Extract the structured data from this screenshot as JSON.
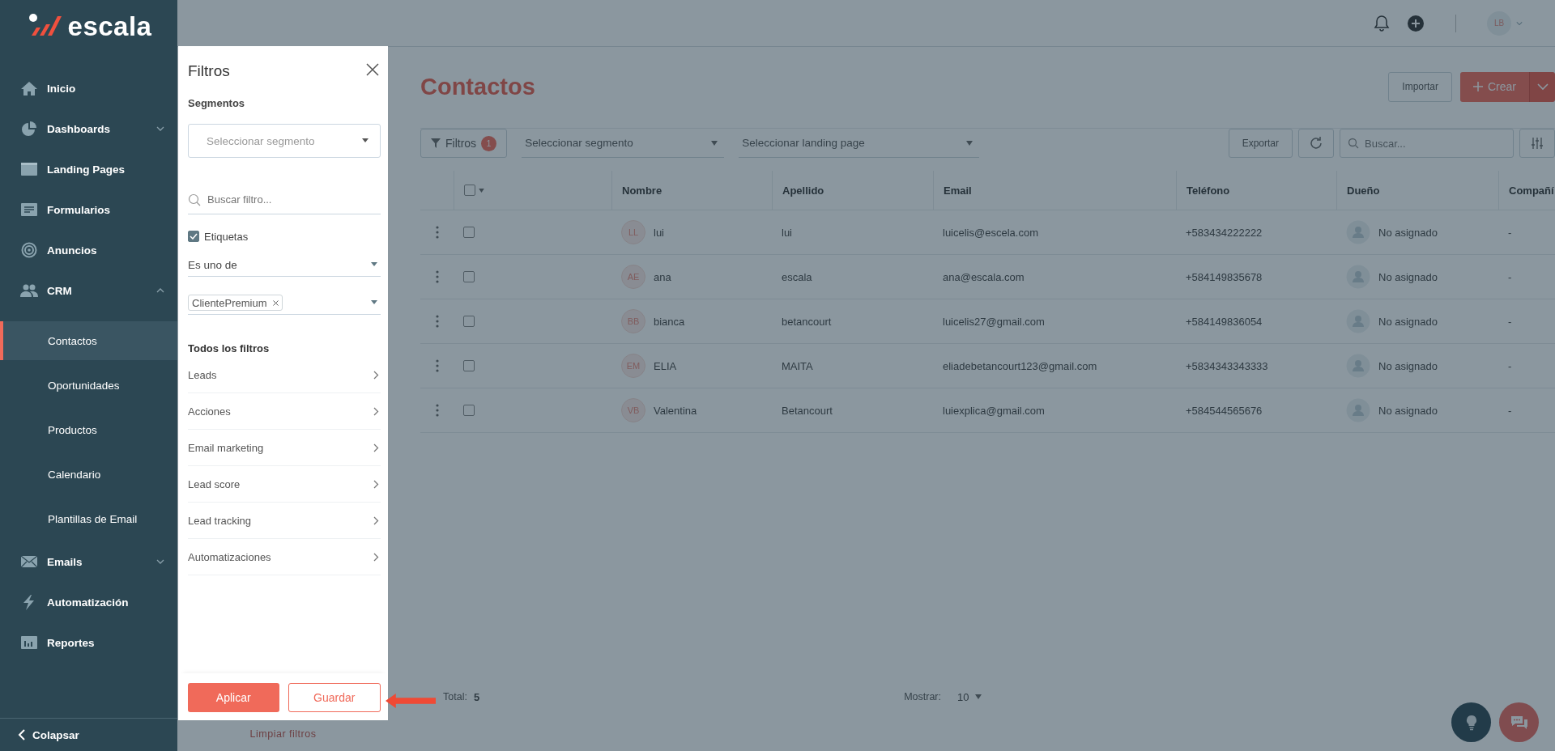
{
  "logo": {
    "text": "escala"
  },
  "sidebar": {
    "items": [
      {
        "label": "Inicio",
        "selected": false
      },
      {
        "label": "Dashboards",
        "selected": false,
        "expanded": false
      },
      {
        "label": "Landing Pages",
        "selected": false
      },
      {
        "label": "Formularios",
        "selected": false
      },
      {
        "label": "Anuncios",
        "selected": false
      },
      {
        "label": "CRM",
        "selected": false,
        "expanded": true,
        "children": [
          {
            "label": "Contactos",
            "selected": true
          },
          {
            "label": "Oportunidades",
            "selected": false
          },
          {
            "label": "Productos",
            "selected": false
          },
          {
            "label": "Calendario",
            "selected": false
          },
          {
            "label": "Plantillas de Email",
            "selected": false
          }
        ]
      },
      {
        "label": "Emails",
        "selected": false,
        "expanded": false
      },
      {
        "label": "Automatización",
        "selected": false
      },
      {
        "label": "Reportes",
        "selected": false
      }
    ],
    "collapse": "Colapsar"
  },
  "header": {
    "user_initials": "LB"
  },
  "page": {
    "title": "Contactos",
    "import_button": "Importar",
    "create_button": "Crear"
  },
  "toolbar": {
    "filters_button": {
      "label": "Filtros",
      "count": "1"
    },
    "segment_select": {
      "placeholder": "Seleccionar segmento"
    },
    "landing_select": {
      "placeholder": "Seleccionar landing page"
    },
    "export_button": "Exportar",
    "search": {
      "placeholder": "Buscar..."
    }
  },
  "table": {
    "select_all": {
      "checked": false
    },
    "columns": [
      "Nombre",
      "Apellido",
      "Email",
      "Teléfono",
      "Dueño",
      "Compañí"
    ],
    "rows": [
      {
        "checked": false,
        "initials": "LL",
        "nombre": "lui",
        "apellido": "lui",
        "email": "luicelis@escela.com",
        "telefono": "+583434222222",
        "dueno": "No asignado",
        "compania": "-"
      },
      {
        "checked": false,
        "initials": "AE",
        "nombre": "ana",
        "apellido": "escala",
        "email": "ana@escala.com",
        "telefono": "+584149835678",
        "dueno": "No asignado",
        "compania": "-"
      },
      {
        "checked": false,
        "initials": "BB",
        "nombre": "bianca",
        "apellido": "betancourt",
        "email": "luicelis27@gmail.com",
        "telefono": "+584149836054",
        "dueno": "No asignado",
        "compania": "-"
      },
      {
        "checked": false,
        "initials": "EM",
        "nombre": "ELIA",
        "apellido": "MAITA",
        "email": "eliadebetancourt123@gmail.com",
        "telefono": "+5834343343333",
        "dueno": "No asignado",
        "compania": "-"
      },
      {
        "checked": false,
        "initials": "VB",
        "nombre": "Valentina",
        "apellido": "Betancourt",
        "email": "luiexplica@gmail.com",
        "telefono": "+584544565676",
        "dueno": "No asignado",
        "compania": "-"
      }
    ]
  },
  "footer": {
    "total_label": "Total:",
    "total": "5",
    "show_label": "Mostrar:",
    "page_size": "10"
  },
  "clear_filters": "Limpiar filtros",
  "filter_panel": {
    "title": "Filtros",
    "segments_label": "Segmentos",
    "segment_select": {
      "placeholder": "Seleccionar segmento"
    },
    "search": {
      "placeholder": "Buscar filtro..."
    },
    "active_filter": {
      "label": "Etiquetas",
      "checked": true,
      "operator": "Es uno de",
      "tags": [
        "ClientePremium"
      ]
    },
    "all_filters_title": "Todos los filtros",
    "filters": [
      "Leads",
      "Acciones",
      "Email marketing",
      "Lead score",
      "Lead tracking",
      "Automatizaciones"
    ],
    "apply_button": "Aplicar",
    "save_button": "Guardar"
  }
}
